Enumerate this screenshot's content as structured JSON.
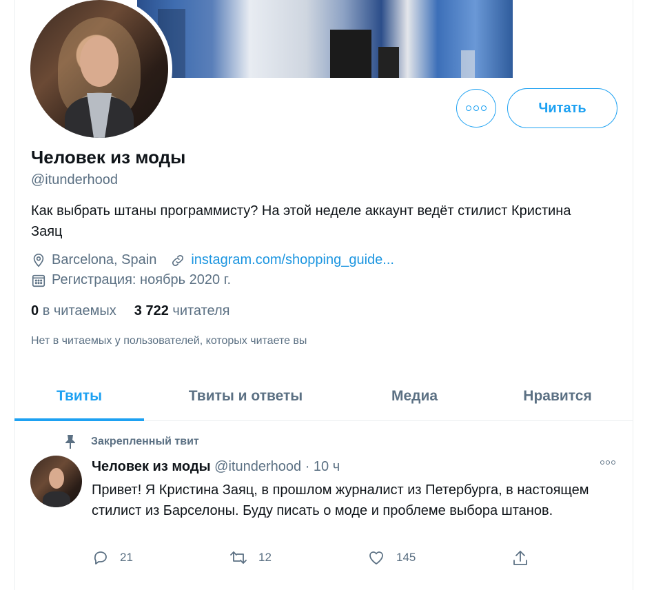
{
  "profile": {
    "name": "Человек из моды",
    "handle": "@itunderhood",
    "bio": "Как выбрать штаны программисту? На этой неделе аккаунт ведёт стилист Кристина Заяц",
    "location": "Barcelona, Spain",
    "website": "instagram.com/shopping_guide...",
    "joined": "Регистрация: ноябрь 2020 г.",
    "following_count": "0",
    "following_label": "в читаемых",
    "followers_count": "3 722",
    "followers_label": "читателя",
    "followers_you_know": "Нет в читаемых у пользователей, которых читаете вы",
    "follow_label": "Читать"
  },
  "tabs": [
    {
      "label": "Твиты",
      "active": true
    },
    {
      "label": "Твиты и ответы",
      "active": false
    },
    {
      "label": "Медиа",
      "active": false
    },
    {
      "label": "Нравится",
      "active": false
    }
  ],
  "tweet": {
    "pinned_label": "Закрепленный твит",
    "author": "Человек из моды",
    "handle": "@itunderhood",
    "separator": "·",
    "time": "10 ч",
    "text": "Привет! Я Кристина Заяц, в прошлом журналист из Петербурга, в настоящем стилист из Барселоны. Буду писать о моде и проблеме выбора штанов.",
    "replies": "21",
    "retweets": "12",
    "likes": "145"
  },
  "colors": {
    "accent": "#1da1f2",
    "link": "#1b95e0",
    "secondary_text": "#5b7083"
  }
}
